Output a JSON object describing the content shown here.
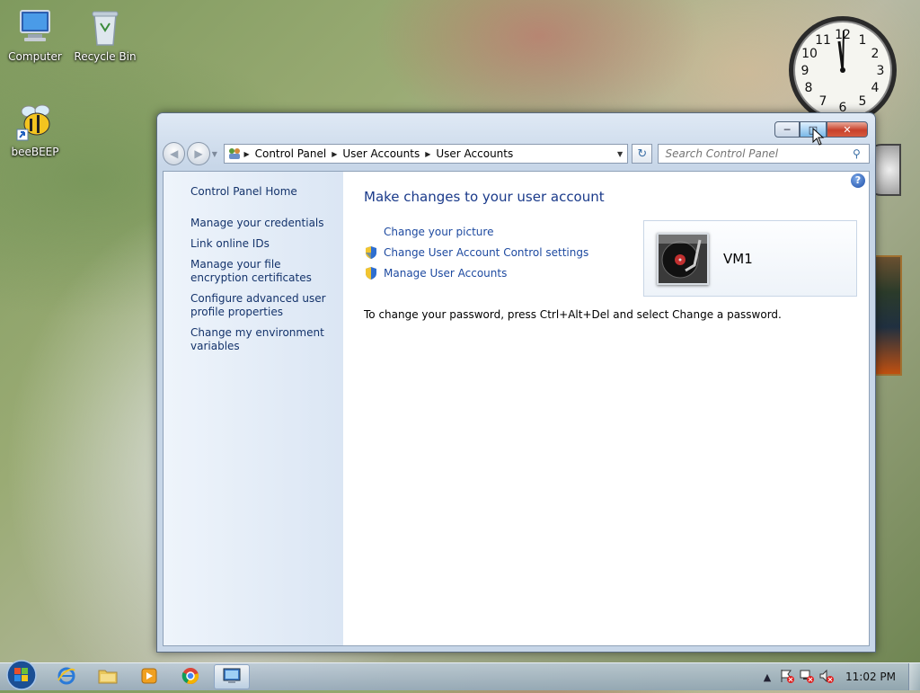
{
  "desktop": {
    "icons": [
      {
        "label": "Computer"
      },
      {
        "label": "Recycle Bin"
      },
      {
        "label": "beeBEEP"
      }
    ]
  },
  "window": {
    "address": {
      "crumbs": [
        "Control Panel",
        "User Accounts",
        "User Accounts"
      ]
    },
    "search": {
      "placeholder": "Search Control Panel"
    },
    "left_pane": {
      "home": "Control Panel Home",
      "links": [
        "Manage your credentials",
        "Link online IDs",
        "Manage your file encryption certificates",
        "Configure advanced user profile properties",
        "Change my environment variables"
      ]
    },
    "main": {
      "title": "Make changes to your user account",
      "tasks": [
        "Change your picture",
        "Change User Account Control settings",
        "Manage User Accounts"
      ],
      "password_note": "To change your password, press Ctrl+Alt+Del and select Change a password.",
      "user_name": "VM1"
    }
  },
  "taskbar": {
    "clock": "11:02 PM"
  },
  "colors": {
    "link": "#14336b",
    "title": "#1a3a8a",
    "close_button": "#c8412b"
  }
}
